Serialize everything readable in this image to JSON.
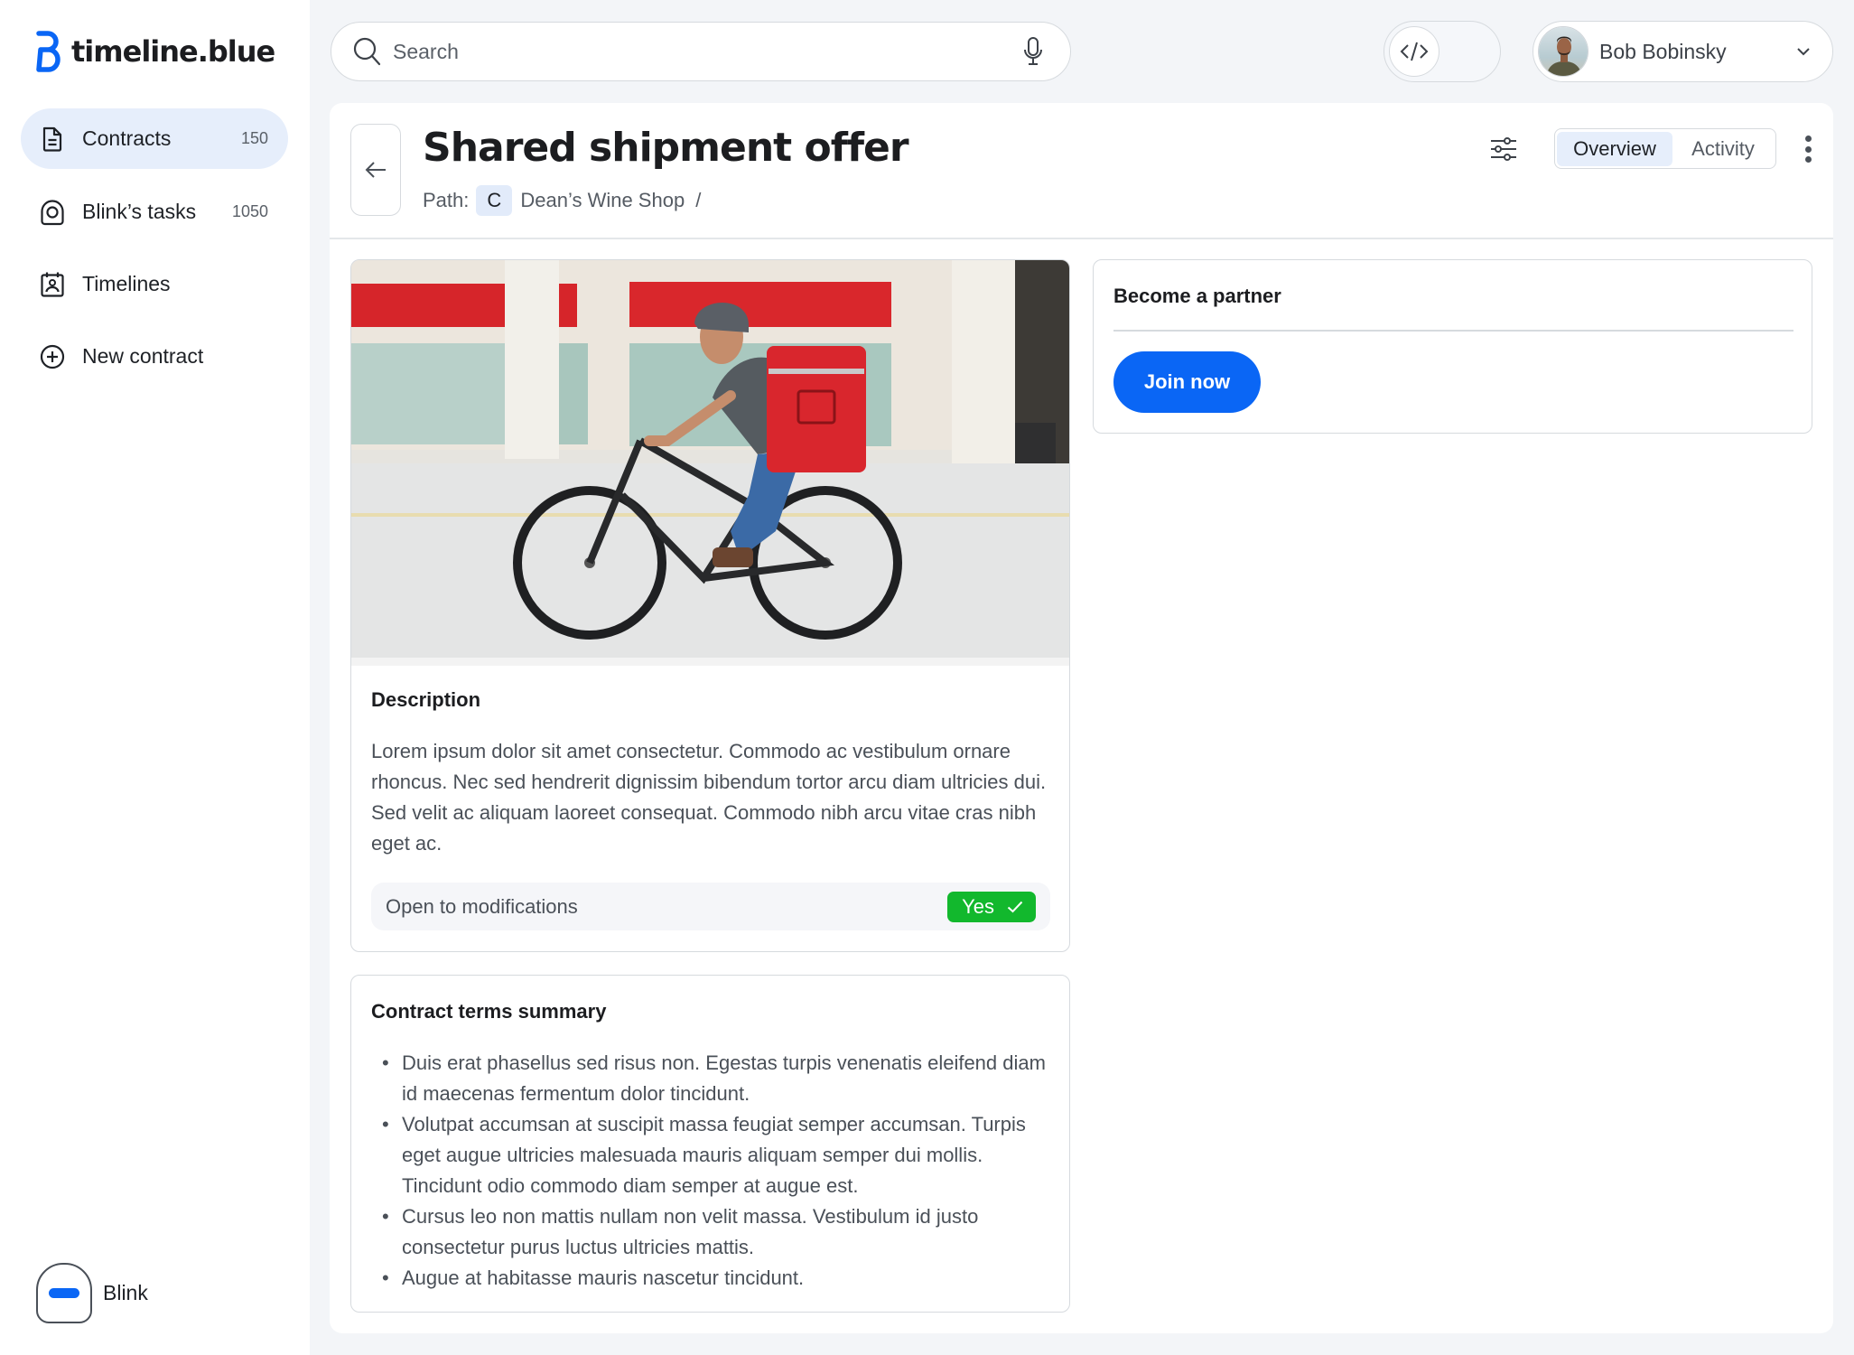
{
  "app": {
    "brand": "timeline.blue",
    "brand_color": "#0a66f5"
  },
  "sidebar": {
    "items": [
      {
        "label": "Contracts",
        "count": "150",
        "icon": "document-icon",
        "active": true
      },
      {
        "label": "Blink’s tasks",
        "count": "1050",
        "icon": "blink-tasks-icon",
        "active": false
      },
      {
        "label": "Timelines",
        "count": "",
        "icon": "calendar-person-icon",
        "active": false
      },
      {
        "label": "New contract",
        "count": "",
        "icon": "plus-circle-icon",
        "active": false
      }
    ],
    "assistant": {
      "label": "Blink",
      "icon": "blink-assistant-icon"
    }
  },
  "topbar": {
    "search": {
      "placeholder": "Search",
      "value": ""
    },
    "code_toggle": {
      "icon": "code-icon",
      "on": false
    },
    "user": {
      "name": "Bob Bobinsky"
    }
  },
  "page": {
    "title": "Shared shipment offer",
    "path_label": "Path:",
    "path_chip": "C",
    "path_item": "Dean’s Wine Shop",
    "path_separator": "/",
    "tabs": [
      {
        "label": "Overview",
        "active": true
      },
      {
        "label": "Activity",
        "active": false
      }
    ]
  },
  "description_card": {
    "image_alt": "Delivery rider on a bicycle with a red insulated backpack",
    "heading": "Description",
    "text": "Lorem ipsum dolor sit amet consectetur. Commodo ac vestibulum ornare rhoncus. Nec sed hendrerit dignissim bibendum tortor arcu diam ultricies dui. Sed velit ac aliquam laoreet consequat. Commodo nibh arcu vitae cras nibh eget ac.",
    "modifications_label": "Open to modifications",
    "modifications_value": "Yes",
    "modifications_color": "#12b82d"
  },
  "terms_card": {
    "heading": "Contract terms summary",
    "items": [
      "Duis erat phasellus sed risus non. Egestas turpis venenatis eleifend diam id maecenas fermentum dolor tincidunt.",
      "Volutpat accumsan at suscipit massa feugiat semper accumsan. Turpis eget augue ultricies malesuada mauris aliquam semper dui mollis. Tincidunt odio commodo diam semper at augue est.",
      "Cursus leo non mattis nullam non velit massa. Vestibulum id justo consectetur purus luctus ultricies mattis.",
      "Augue at habitasse mauris nascetur tincidunt."
    ]
  },
  "partner_card": {
    "heading": "Become a partner",
    "button_label": "Join now"
  }
}
